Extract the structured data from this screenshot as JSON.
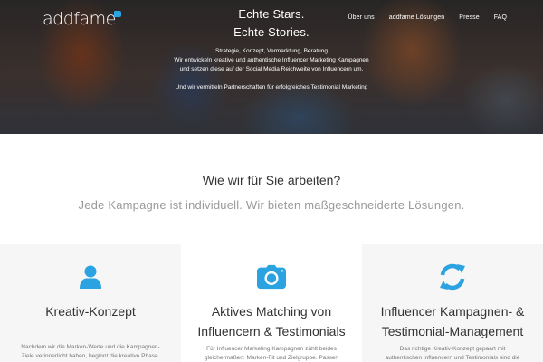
{
  "brand": {
    "logo_text": "addfame",
    "accent": "#2aa3e0"
  },
  "nav": {
    "items": [
      "Über uns",
      "addfame Lösungen",
      "Presse",
      "FAQ"
    ]
  },
  "hero": {
    "title_line1": "Echte Stars.",
    "title_line2": "Echte Stories.",
    "text_line1": "Strategie, Konzept, Vermarktung, Beratung",
    "text_line2": "Wir entwickeln kreative und authentische Influencer Marketing Kampagnen",
    "text_line3": "und setzen diese auf der Social Media Reichweite von Influencern um.",
    "text_line4": "Und wir vermitteln Partnerschaften für erfolgreiches Testimonial Marketing"
  },
  "intro": {
    "title": "Wie wir für Sie arbeiten?",
    "subtitle": "Jede Kampagne ist individuell. Wir bieten maßgeschneiderte Lösungen."
  },
  "cards": [
    {
      "icon": "user-icon",
      "title_line1": "Kreativ-Konzept",
      "title_line2": "",
      "text_line1": "Nachdem wir die Marken-Werte und die Kampagnen-",
      "text_line2": "Ziele verinnerlicht haben, beginnt die kreative Phase."
    },
    {
      "icon": "camera-icon",
      "title_line1": "Aktives Matching von",
      "title_line2": "Influencern & Testimonials",
      "text_line1": "Für Influencer Marketing Kampagnen zählt beides",
      "text_line2": "gleichermaßen: Marken-Fit und Zielgruppe. Passen"
    },
    {
      "icon": "refresh-icon",
      "title_line1": "Influencer Kampagnen- &",
      "title_line2": "Testimonial-Management",
      "text_line1": "Das richtige Kreativ-Konzept gepaart mit",
      "text_line2": "authentischen Influencern und Testimonials sind die"
    }
  ]
}
